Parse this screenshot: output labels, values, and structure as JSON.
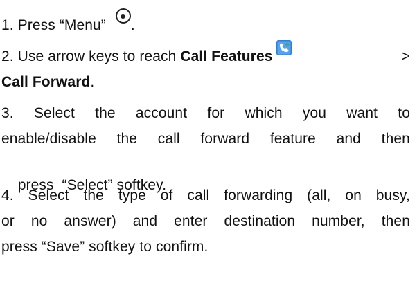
{
  "steps": {
    "s1": {
      "prefix": "1. Press “Menu”",
      "suffix": "."
    },
    "s2": {
      "line1_prefix": "2. Use arrow keys to reach",
      "feature": "Call Features",
      "separator": ">",
      "line2_bold": "Call Forward",
      "line2_suffix": "."
    },
    "s3": {
      "line1_words": [
        "3.",
        "Select",
        "the",
        "account",
        "for",
        "which",
        "you",
        "want",
        "to"
      ],
      "line2_words": [
        "enable/disable",
        "the",
        "call",
        "forward",
        "feature",
        "and",
        "then"
      ],
      "line3": "press  “Select” softkey."
    },
    "s4": {
      "line1_words": [
        "4.",
        "Select",
        "the",
        "type",
        "of",
        "call",
        "forwarding",
        "(all,",
        "on",
        "busy,"
      ],
      "line2_words": [
        "or",
        "no",
        "answer)",
        "and",
        "enter",
        "destination",
        "number,",
        "then"
      ],
      "line3": "press “Save” softkey to confirm."
    }
  },
  "icons": {
    "menu": "menu-button-icon",
    "call_features": "call-features-icon"
  },
  "colors": {
    "text": "#111111",
    "icon_blue": "#2f7fd6",
    "icon_teal": "#3aa6a0"
  }
}
